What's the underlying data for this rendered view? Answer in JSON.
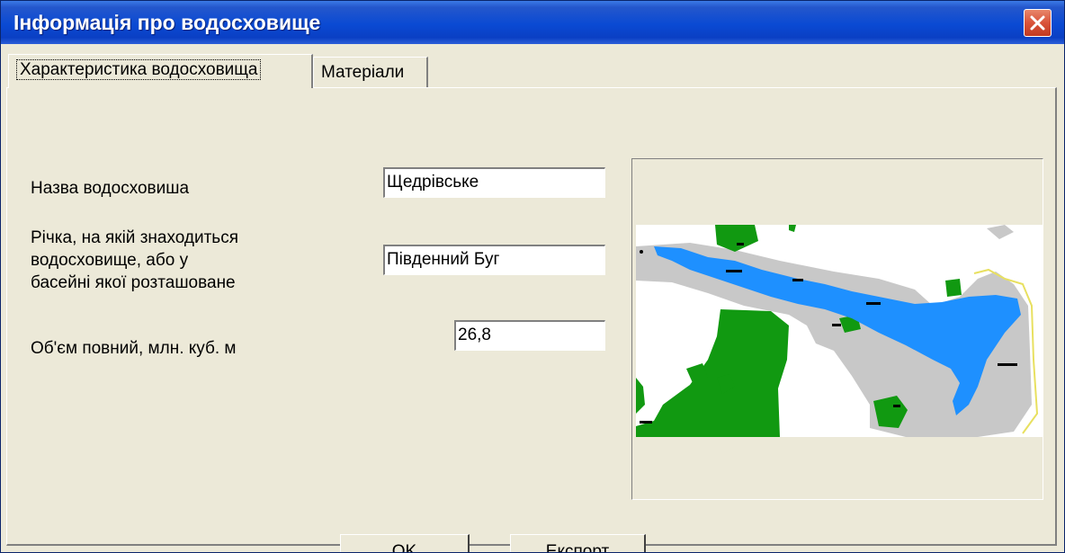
{
  "window": {
    "title": "Інформація про водосховище"
  },
  "tabs": [
    {
      "label": "Характеристика водосховища",
      "active": true
    },
    {
      "label": "Матеріали",
      "active": false
    }
  ],
  "form": {
    "name_label": "Назва  водосховиша",
    "name_value": "Щедрівське",
    "river_label_lines": [
      "Річка, на якій знаходиться",
      "водосховище, або у",
      "басейні якої розташоване"
    ],
    "river_value": "Південний Буг",
    "volume_label": "Об'єм повний, млн. куб. м",
    "volume_value": "26,8"
  },
  "map": {
    "colors": {
      "water": "#1e90ff",
      "forest": "#119911",
      "settlement": "#c8c8c8",
      "background": "#ffffff"
    }
  },
  "buttons": {
    "ok_label": "OK",
    "export_label": "Експорт"
  },
  "icons": {
    "close": "close-x-icon"
  }
}
